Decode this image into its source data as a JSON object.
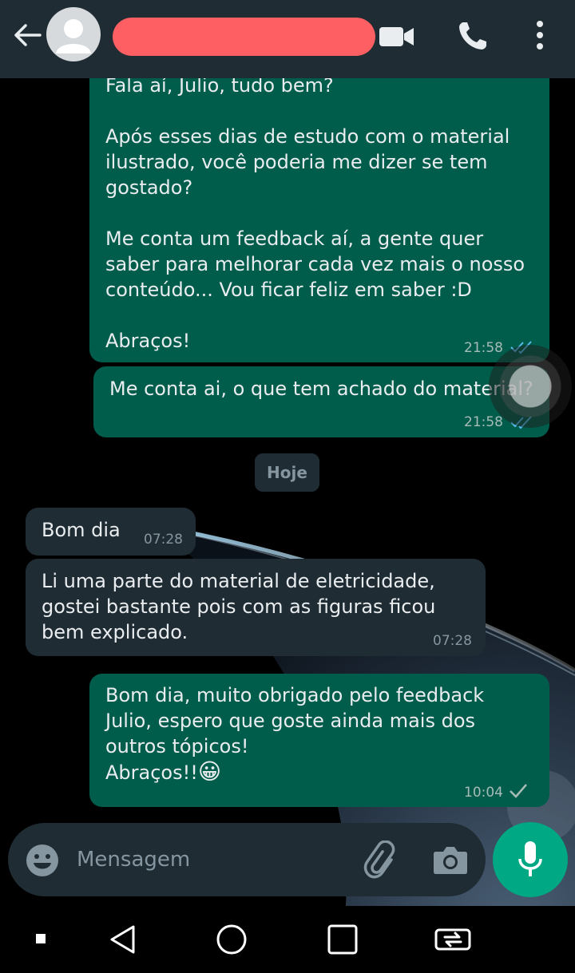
{
  "colors": {
    "header": "#1f2c34",
    "outgoing_bubble": "#005c4b",
    "incoming_bubble": "#1f2c34",
    "read_ticks": "#53bdeb",
    "redaction": "#fd5f63",
    "mic_button": "#00a884"
  },
  "header": {
    "icons": [
      "back-arrow-icon",
      "avatar",
      "video-call-icon",
      "voice-call-icon",
      "more-options-icon"
    ]
  },
  "messages": [
    {
      "direction": "outgoing",
      "text": "Fala aí, Julio, tudo bem?\n\nApós esses dias de estudo com o material ilustrado, você poderia me dizer se tem gostado?\n\nMe conta um feedback aí, a gente quer saber para melhorar cada vez mais o nosso conteúdo... Vou ficar feliz em saber :D\n\nAbraços!",
      "time": "21:58",
      "status": "read"
    },
    {
      "direction": "outgoing",
      "text": "Me conta ai, o que tem achado do material?",
      "time": "21:58",
      "status": "read"
    },
    {
      "direction": "incoming",
      "text": "Bom dia",
      "time": "07:28"
    },
    {
      "direction": "incoming",
      "text": "Li uma parte do material de eletricidade,\ngostei bastante pois com as figuras ficou\nbem explicado.",
      "time": "07:28"
    },
    {
      "direction": "outgoing",
      "text": "Bom dia, muito obrigado pelo feedback\nJulio, espero que goste ainda mais dos\noutros tópicos!\nAbraços!!",
      "emoji": "😀",
      "time": "10:04",
      "status": "sent"
    }
  ],
  "date_divider": "Hoje",
  "composer": {
    "placeholder": "Mensagem",
    "icons": [
      "emoji-icon",
      "attach-icon",
      "camera-icon",
      "mic-icon"
    ]
  },
  "navbar": {
    "icons": [
      "square-dot-icon",
      "back-triangle-icon",
      "home-circle-icon",
      "recents-square-icon",
      "rotate-icon"
    ]
  }
}
